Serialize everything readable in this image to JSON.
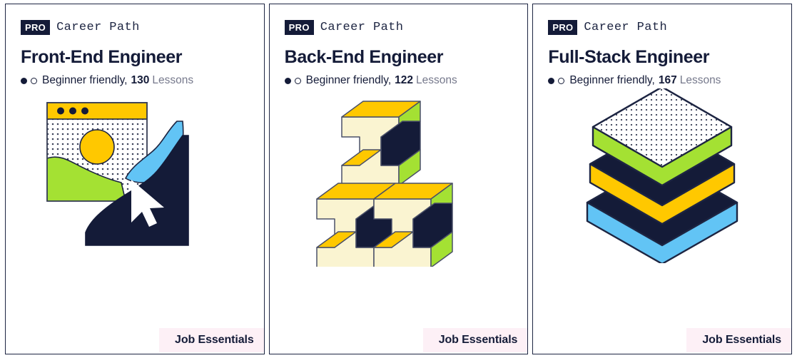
{
  "cards": [
    {
      "id": "front-end-engineer",
      "pro_badge": "PRO",
      "kicker": "Career Path",
      "title": "Front-End Engineer",
      "level": "Beginner friendly,",
      "lesson_count": "130",
      "lesson_word": "Lessons",
      "footer_badge": "Job Essentials",
      "illustration": "browser-landscape-cursor"
    },
    {
      "id": "back-end-engineer",
      "pro_badge": "PRO",
      "kicker": "Career Path",
      "title": "Back-End Engineer",
      "level": "Beginner friendly,",
      "lesson_count": "122",
      "lesson_word": "Lessons",
      "footer_badge": "Job Essentials",
      "illustration": "isometric-i-beams"
    },
    {
      "id": "full-stack-engineer",
      "pro_badge": "PRO",
      "kicker": "Career Path",
      "title": "Full-Stack Engineer",
      "level": "Beginner friendly,",
      "lesson_count": "167",
      "lesson_word": "Lessons",
      "footer_badge": "Job Essentials",
      "illustration": "isometric-stacked-layers"
    }
  ],
  "difficulty_indicator": {
    "filled_dots": 1,
    "hollow_dots": 1
  },
  "colors": {
    "navy": "#141b38",
    "yellow": "#ffc800",
    "green": "#a4e133",
    "blue": "#62c4f5",
    "cream": "#faf4d1",
    "badge_pink": "#fdf0f6",
    "card_border": "#1d2542",
    "muted_text": "#76798c"
  }
}
